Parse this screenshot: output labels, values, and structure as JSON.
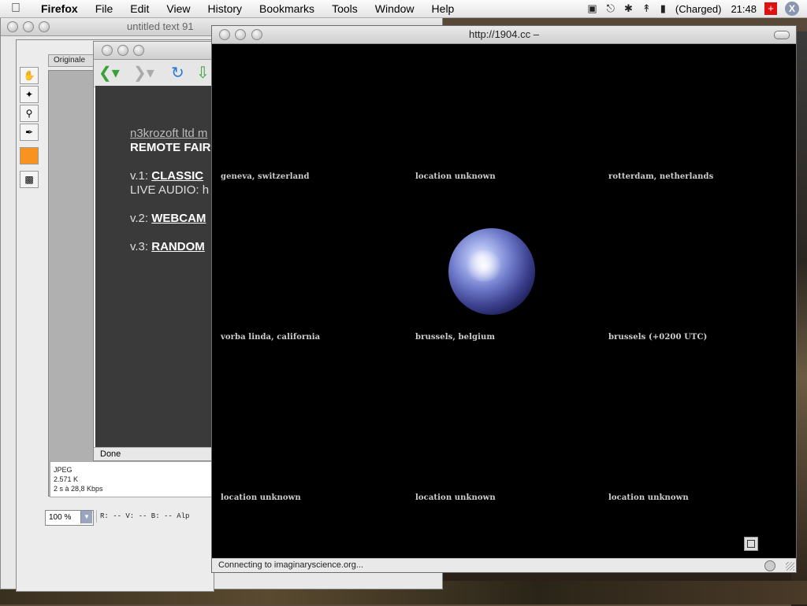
{
  "menubar": {
    "app_name": "Firefox",
    "menus": [
      "File",
      "Edit",
      "View",
      "History",
      "Bookmarks",
      "Tools",
      "Window",
      "Help"
    ],
    "battery_text": "(Charged)",
    "clock": "21:48",
    "extra_icon_letter": "X"
  },
  "text_window": {
    "title": "untitled text 91"
  },
  "preview_window": {
    "tab_label": "Originale",
    "info_format": "JPEG",
    "info_size": "2.571 K",
    "info_speed": "2 s à 28,8 Kbps",
    "zoom_value": "100 %",
    "rgb_readout": "R:  --  V:  --  B:  --  Alp"
  },
  "firefox_window": {
    "content_line1": "n3krozoft ltd m",
    "content_line2": "REMOTE FAIR",
    "v1_prefix": "v.1:",
    "v1_link": "CLASSIC",
    "live_audio": "LIVE AUDIO: h",
    "v2_prefix": "v.2:",
    "v2_link": "WEBCAM",
    "v3_prefix": "v.3:",
    "v3_link": "RANDOM",
    "status": "Done"
  },
  "main_window": {
    "title": "http://1904.cc –",
    "locations": [
      "geneva, switzerland",
      "location unknown",
      "rotterdam, netherlands",
      "vorba linda, california",
      "brussels, belgium",
      "brussels (+0200 UTC)",
      "location unknown",
      "location unknown",
      "location unknown"
    ],
    "status": "Connecting to imaginaryscience.org..."
  }
}
